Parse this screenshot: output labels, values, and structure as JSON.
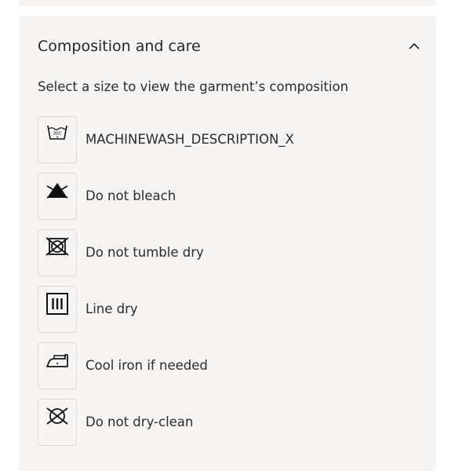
{
  "section": {
    "title": "Composition and care",
    "expanded": true,
    "toggle_icon": "chevron-up-icon",
    "subtitle": "Select a size to view the garment’s composition"
  },
  "care": {
    "items": [
      {
        "icon": "machine-wash-30-icon",
        "icon_text": "30C",
        "label": "MACHINEWASH_DESCRIPTION_X"
      },
      {
        "icon": "do-not-bleach-icon",
        "label": "Do not bleach"
      },
      {
        "icon": "do-not-tumble-dry-icon",
        "label": "Do not tumble dry"
      },
      {
        "icon": "line-dry-icon",
        "label": "Line dry"
      },
      {
        "icon": "cool-iron-icon",
        "label": "Cool iron if needed"
      },
      {
        "icon": "do-not-dry-clean-icon",
        "label": "Do not dry-clean"
      }
    ]
  },
  "colors": {
    "panel_background": "#f7f5f3",
    "text": "#2b2b2b",
    "icon_border": "#dcd8d4"
  }
}
